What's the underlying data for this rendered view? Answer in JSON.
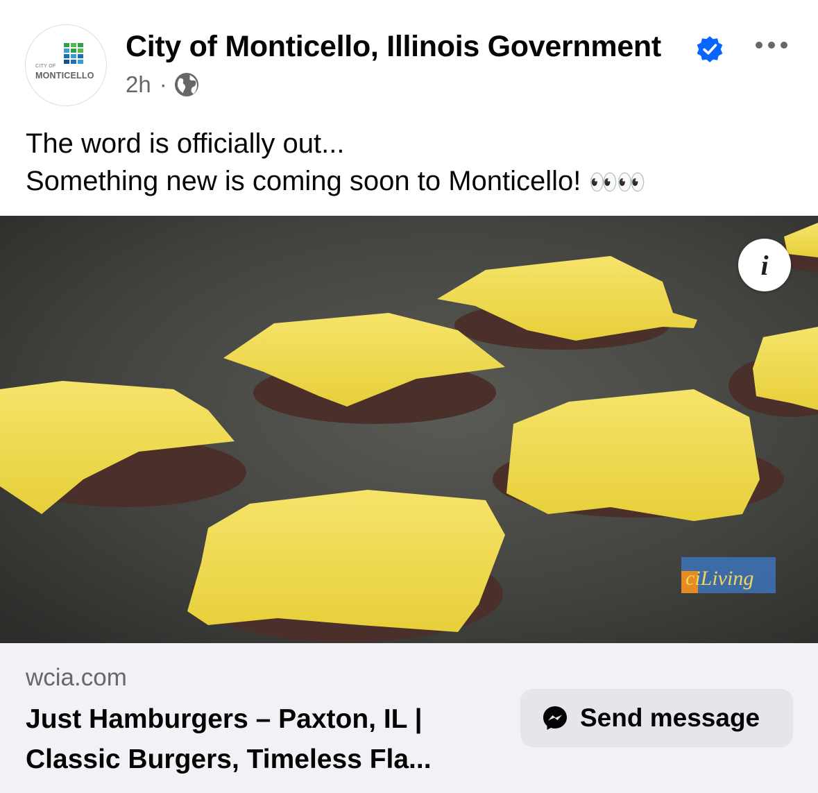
{
  "header": {
    "page_name": "City of Monticello, Illinois Government",
    "time": "2h",
    "separator": "·",
    "avatar": {
      "line1": "CITY OF",
      "line2": "MONTICELLO"
    },
    "icons": {
      "verified": "verified-badge-icon",
      "privacy": "globe-icon",
      "more": "more-options-icon"
    }
  },
  "post": {
    "line1": "The word is officially out...",
    "line2": "Something new is coming soon to Monticello!",
    "emoji": "👀👀"
  },
  "media": {
    "watermark": "ciLiving",
    "info_icon_glyph": "i"
  },
  "link_preview": {
    "domain": "wcia.com",
    "title_line1": "Just Hamburgers – Paxton, IL |",
    "title_line2": "Classic Burgers, Timeless Fla...",
    "button_label": "Send message"
  },
  "colors": {
    "verified_blue": "#0866ff",
    "secondary_text": "#65676b",
    "footer_bg": "#f0f2f5",
    "button_bg": "#e4e6eb",
    "cheese": "#f2dc4f"
  }
}
